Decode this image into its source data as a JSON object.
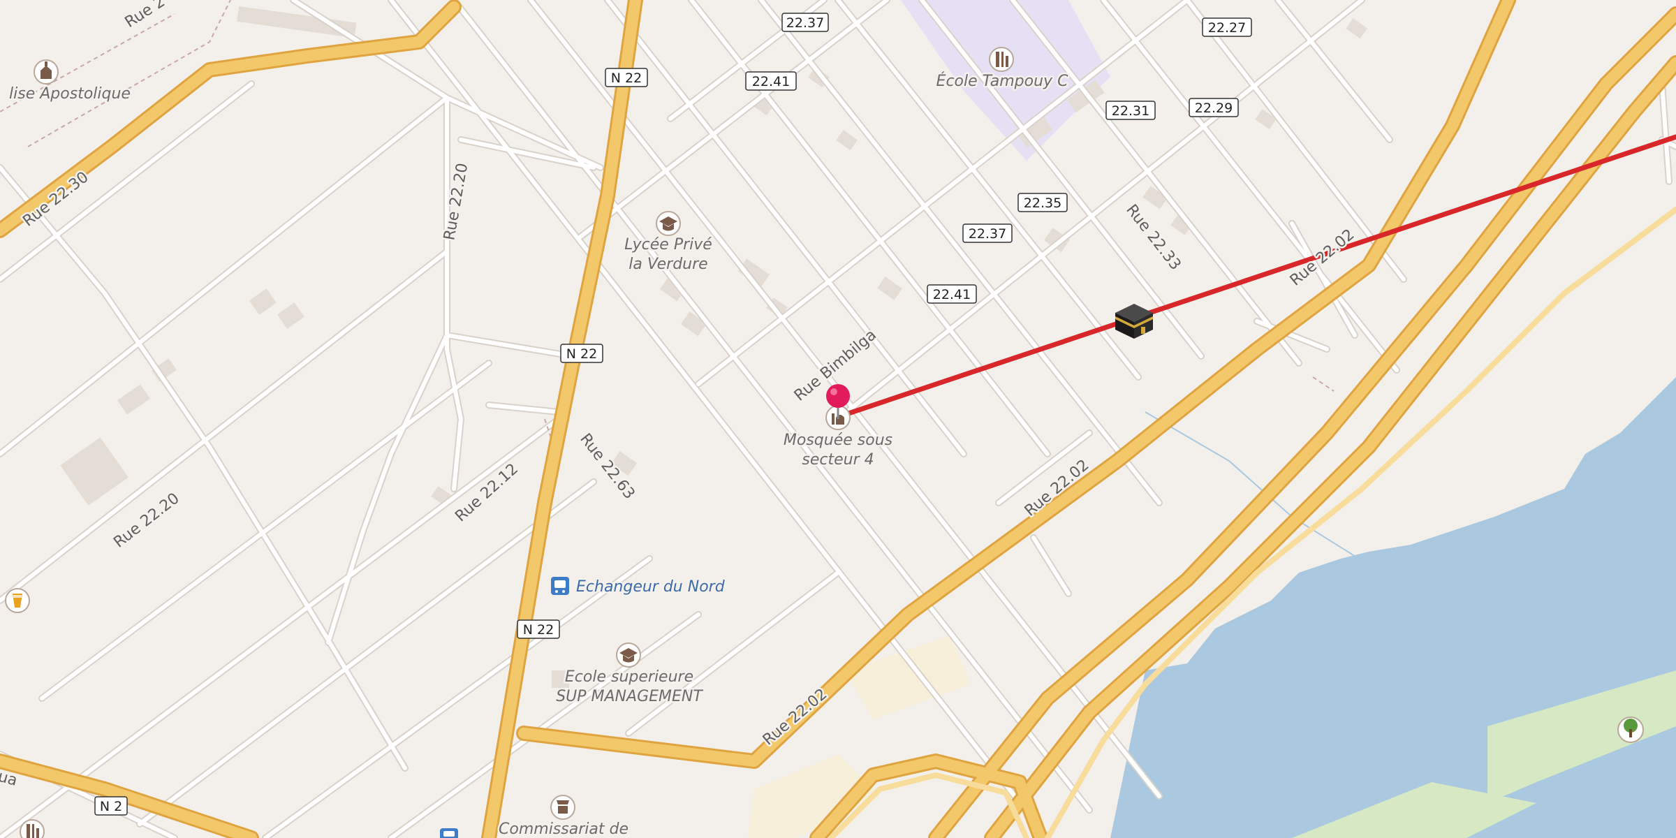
{
  "colors": {
    "background": "#f3efea",
    "road_major": "#f2c86a",
    "road_major_casing": "#dfa43f",
    "road_minor": "#ffffff",
    "road_minor_casing": "#d8d2cb",
    "water": "#aac9e0",
    "school_area": "#e6e0f5",
    "park_area": "#d6e8c4",
    "sand_area": "#f7efd9",
    "building": "#e4ddd5",
    "route_line": "#d9262a",
    "pin": "#e21b5a"
  },
  "route_shields": [
    {
      "name": "n22-shield-top",
      "text": "N 22"
    },
    {
      "name": "n22-shield-mid",
      "text": "N 22"
    },
    {
      "name": "n22-shield-bottom",
      "text": "N 22"
    },
    {
      "name": "n2-shield",
      "text": "N 2"
    },
    {
      "name": "shield-22-37-top",
      "text": "22.37"
    },
    {
      "name": "shield-22-41-top",
      "text": "22.41"
    },
    {
      "name": "shield-22-27",
      "text": "22.27"
    },
    {
      "name": "shield-22-31",
      "text": "22.31"
    },
    {
      "name": "shield-22-29",
      "text": "22.29"
    },
    {
      "name": "shield-22-35",
      "text": "22.35"
    },
    {
      "name": "shield-22-37-mid",
      "text": "22.37"
    },
    {
      "name": "shield-22-41-mid",
      "text": "22.41"
    }
  ],
  "street_labels": {
    "rue_22_top_left": "Rue 2",
    "rue_22_30": "Rue 22.30",
    "rue_22_20_a": "Rue 22.20",
    "rue_22_20_b": "Rue 22.20",
    "rue_22_12": "Rue 22.12",
    "rue_22_63": "Rue 22.63",
    "rue_bimbilga": "Rue Bimbilga",
    "rue_22_33": "Rue 22.33",
    "rue_22_02_a": "Rue 22.02",
    "rue_22_02_b": "Rue 22.02",
    "rue_22_02_c": "Rue 22.02",
    "partial_left": "ua"
  },
  "pois": {
    "eglise": "lise Apostolique",
    "ecole_tampouy": "École Tampouy C",
    "lycee_line1": "Lycée Privé",
    "lycee_line2": "la Verdure",
    "mosquee_line1": "Mosquée sous",
    "mosquee_line2": "secteur 4",
    "echangeur": "Echangeur du Nord",
    "ecole_sup_line1": "Ecole superieure",
    "ecole_sup_line2": "SUP MANAGEMENT",
    "commissariat": "Commissariat de"
  },
  "icons": {
    "church": "church-icon",
    "school": "school-icon",
    "graduation": "graduation-cap-icon",
    "mosque": "mosque-icon",
    "bus": "bus-stop-icon",
    "police": "police-icon",
    "kaaba": "kaaba-icon",
    "tree": "tree-icon",
    "drink": "drink-icon",
    "pin": "map-pin-icon"
  }
}
